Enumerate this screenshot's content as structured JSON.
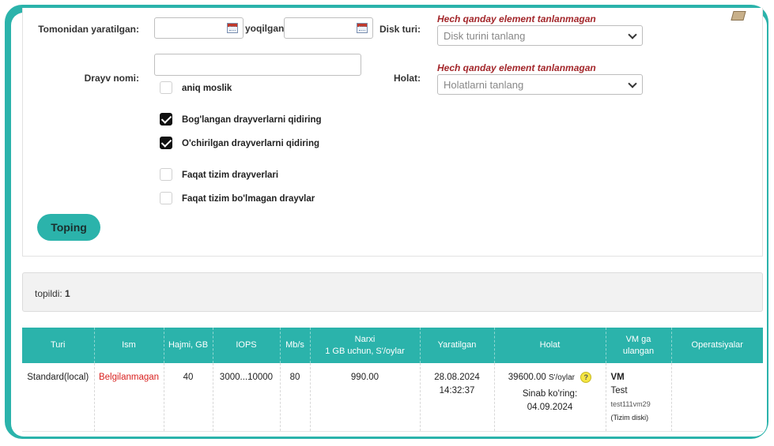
{
  "filters": {
    "created_label": "Tomonidan yaratilgan:",
    "created_sep": "yoqilgan",
    "disk_type_label": "Disk turi:",
    "disk_type_warning": "Hech qanday element tanlanmagan",
    "disk_type_placeholder": "Disk turini tanlang",
    "drive_name_label": "Drayv nomi:",
    "exact_match": "aniq moslik",
    "status_label": "Holat:",
    "status_warning": "Hech qanday element tanlanmagan",
    "status_placeholder": "Holatlarni tanlang",
    "connected_drives": "Bog'langan drayverlarni qidiring",
    "deleted_drives": "O'chirilgan drayverlarni qidiring",
    "system_only": "Faqat tizim drayverlari",
    "non_system_only": "Faqat tizim bo'lmagan drayvlar",
    "search_button": "Toping",
    "checkbox_state": {
      "exact": false,
      "connected": true,
      "deleted": true,
      "system": false,
      "nonsystem": false
    }
  },
  "result": {
    "found_label": "topildi:",
    "found_count": "1"
  },
  "table": {
    "headers": [
      "Turi",
      "Ism",
      "Hajmi, GB",
      "IOPS",
      "Mb/s",
      "Narxi",
      "1 GB uchun, S'/oylar",
      "Yaratilgan",
      "Holat",
      "VM ga",
      "ulangan",
      "Operatsiyalar"
    ],
    "row": {
      "type": "Standard(local)",
      "name": "Belgilanmagan",
      "size": "40",
      "iops": "3000...10000",
      "mbs": "80",
      "price": "990.00",
      "created_date": "28.08.2024",
      "created_time": "14:32:37",
      "status_amount": "39600.00",
      "status_unit": "S'/oylar",
      "status_help": "?",
      "trial_label": "Sinab ko'ring:",
      "trial_date": "04.09.2024",
      "vm_label": "VM",
      "vm_name": "Test",
      "vm_id": "test111vm29",
      "vm_disk": "(Tizim diski)"
    }
  }
}
